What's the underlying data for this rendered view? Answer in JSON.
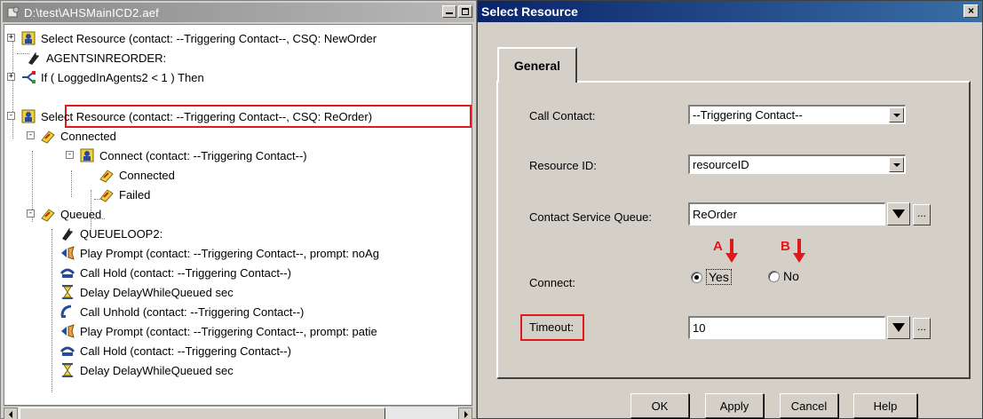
{
  "editor": {
    "title": "D:\\test\\AHSMainICD2.aef",
    "tree": [
      {
        "label": "Select Resource (contact: --Triggering Contact--, CSQ: NewOrder",
        "icon": "select-resource-icon",
        "expander": "+"
      },
      {
        "label": "AGENTSINREORDER:",
        "icon": "label-icon",
        "expander": ""
      },
      {
        "label": "If ( LoggedInAgents2 < 1 ) Then",
        "icon": "if-icon",
        "expander": "+"
      },
      {
        "label": "Select Resource (contact: --Triggering Contact--, CSQ: ReOrder)",
        "icon": "select-resource-icon",
        "expander": "-"
      },
      {
        "label": "Connected",
        "icon": "branch-icon",
        "expander": "-"
      },
      {
        "label": "Connect (contact: --Triggering Contact--)",
        "icon": "connect-icon",
        "expander": "-"
      },
      {
        "label": "Connected",
        "icon": "branch-icon",
        "expander": ""
      },
      {
        "label": "Failed",
        "icon": "branch-icon",
        "expander": ""
      },
      {
        "label": "Queued",
        "icon": "branch-icon",
        "expander": "-"
      },
      {
        "label": "QUEUELOOP2:",
        "icon": "label-icon",
        "expander": ""
      },
      {
        "label": "Play Prompt (contact: --Triggering Contact--, prompt: noAg",
        "icon": "play-prompt-icon",
        "expander": ""
      },
      {
        "label": "Call Hold (contact: --Triggering Contact--)",
        "icon": "call-hold-icon",
        "expander": ""
      },
      {
        "label": "Delay DelayWhileQueued sec",
        "icon": "hourglass-icon",
        "expander": ""
      },
      {
        "label": "Call Unhold (contact: --Triggering Contact--)",
        "icon": "call-unhold-icon",
        "expander": ""
      },
      {
        "label": "Play Prompt (contact: --Triggering Contact--, prompt: patie",
        "icon": "play-prompt-icon",
        "expander": ""
      },
      {
        "label": "Call Hold (contact: --Triggering Contact--)",
        "icon": "call-hold-icon",
        "expander": ""
      },
      {
        "label": "Delay DelayWhileQueued sec",
        "icon": "hourglass-icon",
        "expander": ""
      }
    ]
  },
  "dialog": {
    "title": "Select Resource",
    "close_label": "×",
    "tab_label": "General",
    "call_contact_label": "Call Contact:",
    "call_contact_value": "--Triggering Contact--",
    "resource_id_label": "Resource ID:",
    "resource_id_value": "resourceID",
    "csq_label": "Contact Service Queue:",
    "csq_value": "ReOrder",
    "ellipsis": "...",
    "connect_label": "Connect:",
    "yes_label": "Yes",
    "no_label": "No",
    "connect_selected": "Yes",
    "timeout_label": "Timeout:",
    "timeout_value": "10",
    "marker_a": "A",
    "marker_b": "B",
    "annotation_color": "#e0191b",
    "buttons": {
      "ok": "OK",
      "apply": "Apply",
      "cancel": "Cancel",
      "help": "Help"
    }
  }
}
